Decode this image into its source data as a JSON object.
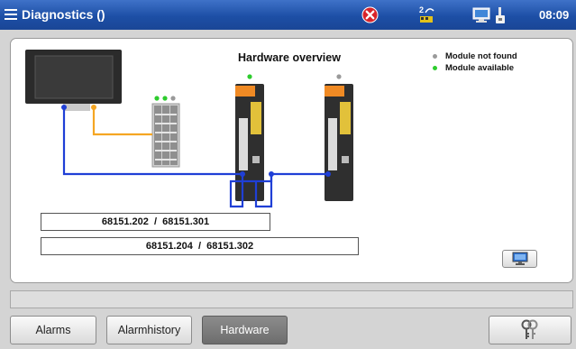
{
  "titlebar": {
    "title": "Diagnostics ()",
    "time": "08:09",
    "icons": [
      "menu-icon",
      "error-icon",
      "network-icon",
      "pc-icon",
      "lock-icon"
    ],
    "accent": "#1d4fa6"
  },
  "panel": {
    "title": "Hardware overview",
    "legend": [
      {
        "label": "Module not found",
        "color": "#9a9a9a"
      },
      {
        "label": "Module available",
        "color": "#2ecc2e"
      }
    ],
    "module_codes": [
      {
        "first": "68151.202",
        "sep": "/",
        "second": "68151.301"
      },
      {
        "first": "68151.204",
        "sep": "/",
        "second": "68151.302"
      }
    ],
    "module_status": {
      "io_module": [
        "available",
        "available",
        "not-found"
      ],
      "drive_1": "available",
      "drive_2": "not-found"
    },
    "connection_colors": {
      "bus": "#1f3fd6",
      "power": "#f5a623"
    }
  },
  "tabs": [
    {
      "label": "Alarms",
      "active": false
    },
    {
      "label": "Alarmhistory",
      "active": false
    },
    {
      "label": "Hardware",
      "active": true
    }
  ],
  "tools_button_icon": "keys-icon"
}
